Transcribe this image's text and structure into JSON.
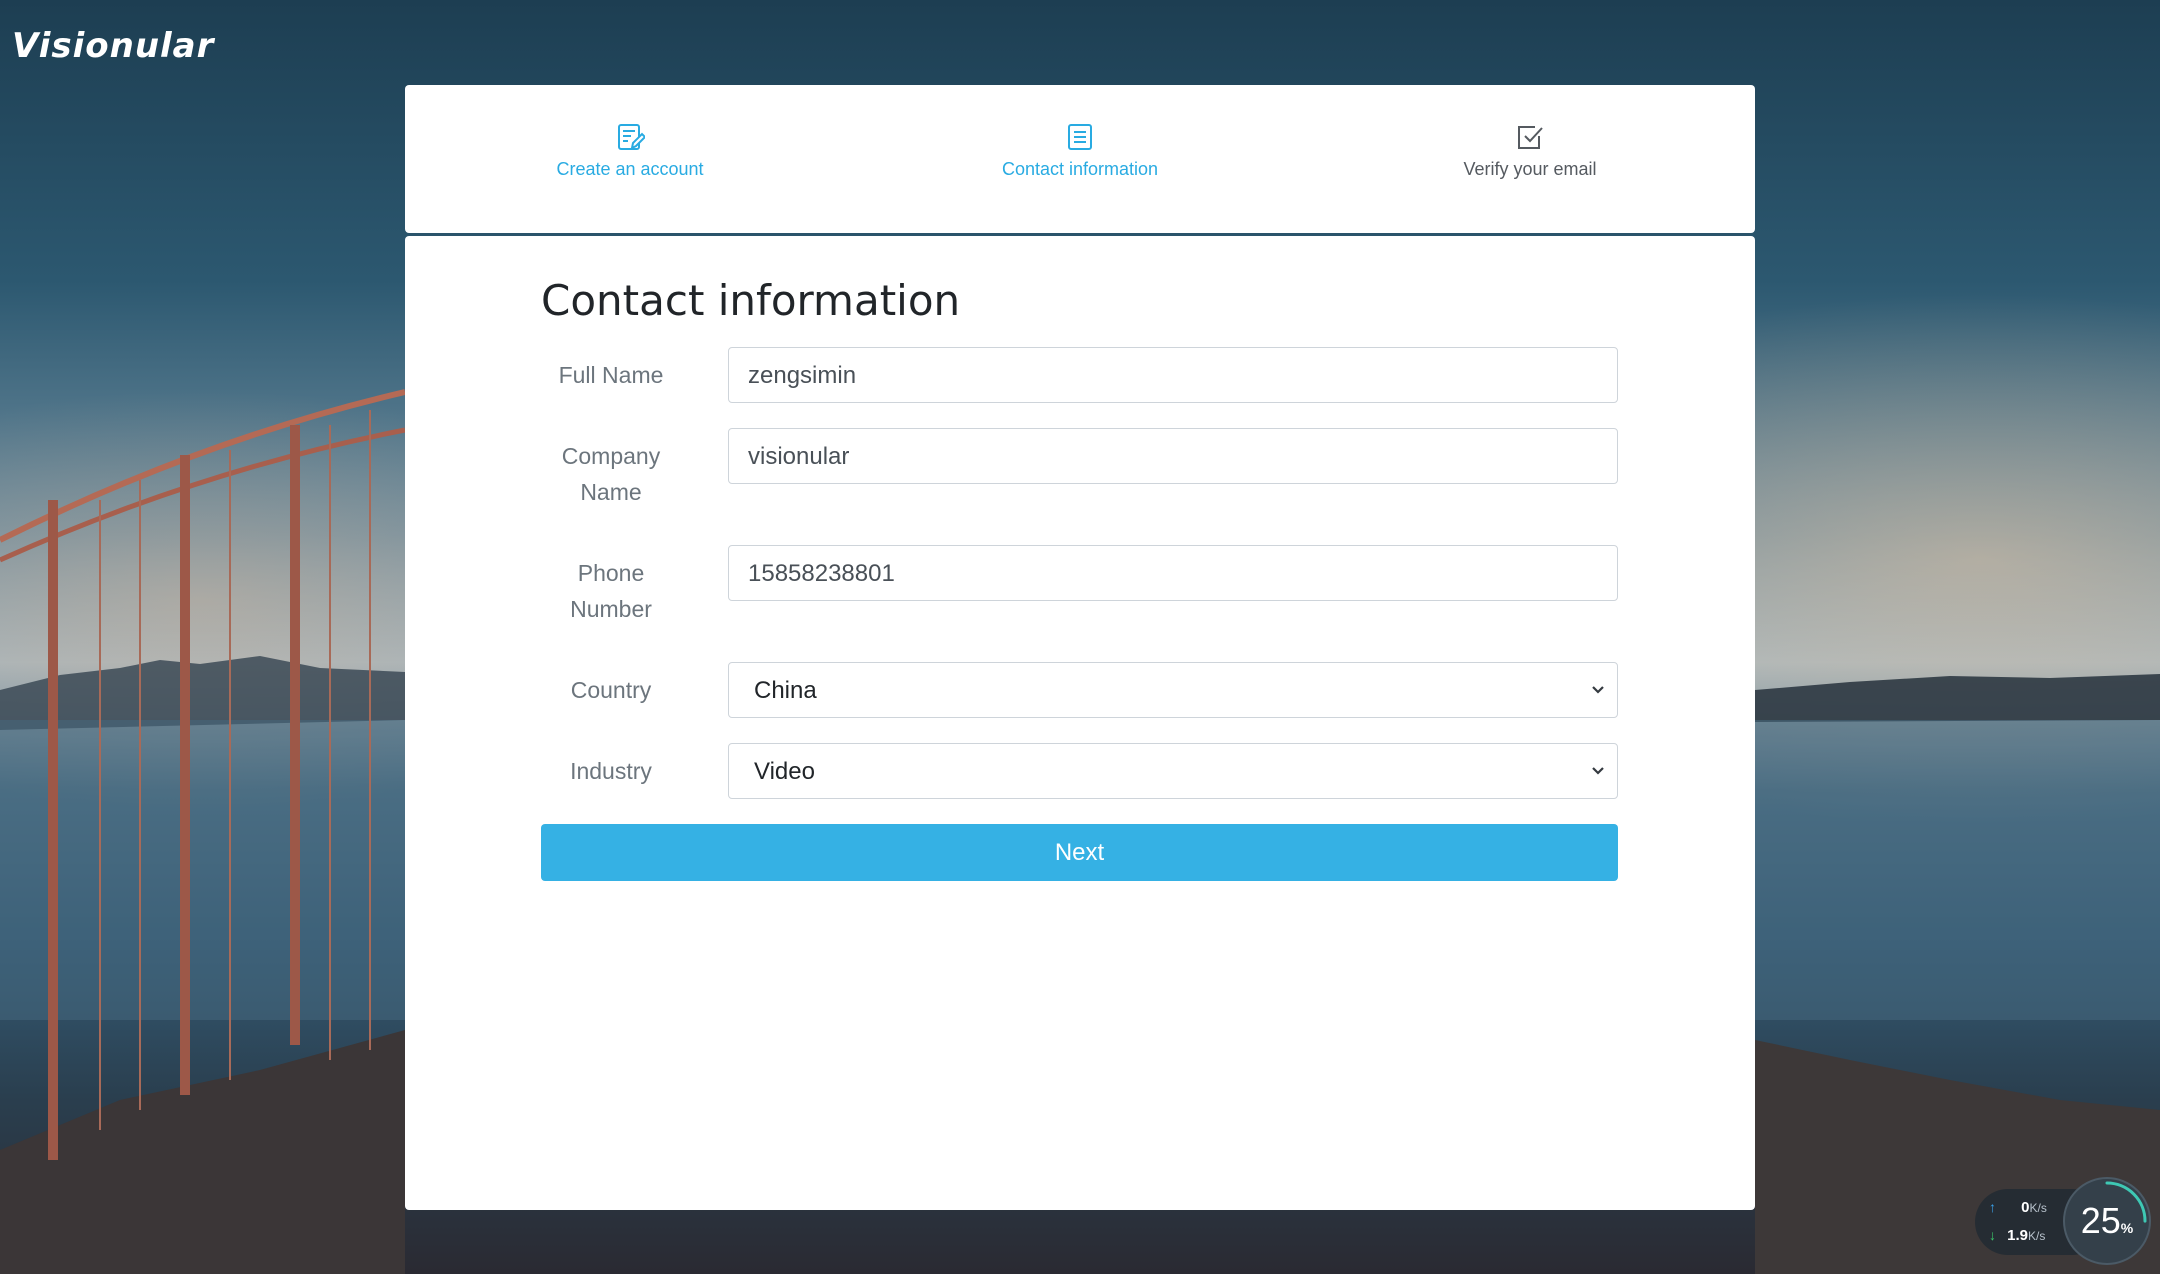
{
  "app": {
    "logo_text": "Visionular"
  },
  "steps": [
    {
      "label": "Create an account",
      "icon": "edit-document-icon",
      "state": "completed"
    },
    {
      "label": "Contact information",
      "icon": "list-document-icon",
      "state": "active"
    },
    {
      "label": "Verify your email",
      "icon": "checkbox-icon",
      "state": "pending"
    }
  ],
  "form": {
    "title": "Contact information",
    "full_name": {
      "label": "Full Name",
      "value": "zengsimin"
    },
    "company_name": {
      "label_line1": "Company",
      "label_line2": "Name",
      "value": "visionular"
    },
    "phone_number": {
      "label_line1": "Phone",
      "label_line2": "Number",
      "value": "15858238801"
    },
    "country": {
      "label": "Country",
      "selected": "China"
    },
    "industry": {
      "label": "Industry",
      "selected": "Video"
    },
    "next_label": "Next"
  },
  "net_monitor": {
    "upload_value": "0",
    "upload_unit": "K/s",
    "download_value": "1.9",
    "download_unit": "K/s",
    "usage_value": "25",
    "usage_unit": "%",
    "usage_fraction": 0.25
  },
  "colors": {
    "accent": "#29abe2",
    "button": "#35b1e4",
    "label_gray": "#6c757d"
  }
}
